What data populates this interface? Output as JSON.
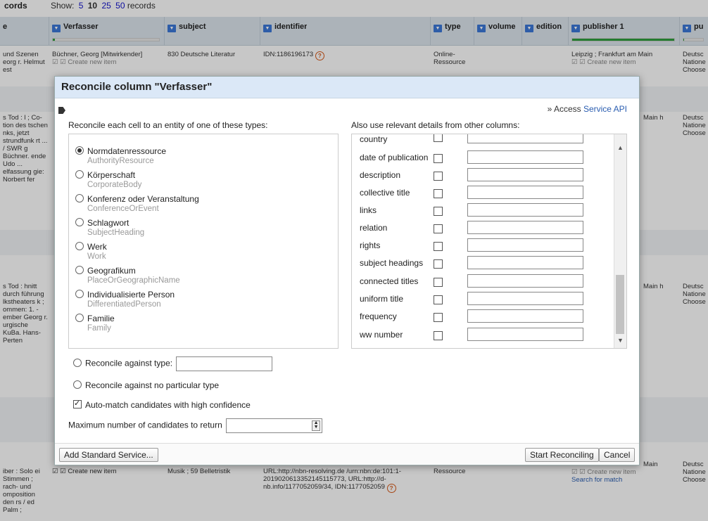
{
  "topbar": {
    "records_label": "cords",
    "show_label": "Show:",
    "opt5": "5",
    "opt10": "10",
    "opt25": "25",
    "opt50": "50",
    "records_suffix": "records"
  },
  "columns": [
    {
      "name": "e",
      "has_menu": false
    },
    {
      "name": "Verfasser",
      "has_menu": true
    },
    {
      "name": "subject",
      "has_menu": true
    },
    {
      "name": "identifier",
      "has_menu": true
    },
    {
      "name": "type",
      "has_menu": true
    },
    {
      "name": "volume",
      "has_menu": true
    },
    {
      "name": "edition",
      "has_menu": true
    },
    {
      "name": "publisher 1",
      "has_menu": true
    },
    {
      "name": "pu",
      "has_menu": true
    }
  ],
  "grid": {
    "row1": {
      "c0": "und Szenen eorg r. Helmut est",
      "c1": "Büchner, Georg [Mitwirkender]",
      "c1b": "Create new item",
      "c2": "830 Deutsche Literatur",
      "c3": "IDN:1186196173",
      "c4": "Online-Ressource",
      "c7": "Leipzig ; Frankfurt am Main",
      "c7b": "Create new item",
      "c8": "Deutsc Natione Choose"
    },
    "row2": {
      "c0": "s Tod : l ; Co- tion des tschen nks, jetzt strundfunk rt ... / SWR g Büchner. ende Udo ... elfassung gie: Norbert fer",
      "c7": "Main h",
      "c8": "Deutsc Natione Choose"
    },
    "row3": {
      "c0": "s Tod : hnitt durch führung lkstheaters k ; ommen: 1. - ember Georg r. urgische KuBa. Hans- Perten",
      "c7": "Main h",
      "c8": "Deutsc Natione Choose"
    },
    "row4": {
      "c0": "iber : Solo ei Stimmen ; rach- und omposition den rs / ed Palm ;",
      "c1": "Create new item",
      "c2": "Musik ; 59 Belletristik",
      "c3": "URL:http://nbn-resolving.de /urn:nbn:de:101:1-2019020613352145115773, URL:http://d-nb.info/1177052059/34, IDN:1177052059",
      "c4": "Ressource",
      "c7": "Main",
      "c7b": "Create new item",
      "c7c": "Search for match",
      "c8": "Deutsc Natione Choose"
    }
  },
  "dialog": {
    "title": "Reconcile column \"Verfasser\"",
    "access_prefix": "» Access",
    "access_link": "Service API",
    "left_label": "Reconcile each cell to an entity of one of these types:",
    "right_label": "Also use relevant details from other columns:",
    "types": [
      {
        "name": "Normdatenressource",
        "id": "AuthorityResource",
        "selected": true
      },
      {
        "name": "Körperschaft",
        "id": "CorporateBody",
        "selected": false
      },
      {
        "name": "Konferenz oder Veranstaltung",
        "id": "ConferenceOrEvent",
        "selected": false
      },
      {
        "name": "Schlagwort",
        "id": "SubjectHeading",
        "selected": false
      },
      {
        "name": "Werk",
        "id": "Work",
        "selected": false
      },
      {
        "name": "Geografikum",
        "id": "PlaceOrGeographicName",
        "selected": false
      },
      {
        "name": "Individualisierte Person",
        "id": "DifferentiatedPerson",
        "selected": false
      },
      {
        "name": "Familie",
        "id": "Family",
        "selected": false
      }
    ],
    "columns_list": [
      "country",
      "date of publication",
      "description",
      "collective title",
      "links",
      "relation",
      "rights",
      "subject headings",
      "connected titles",
      "uniform title",
      "frequency",
      "ww number"
    ],
    "reconcile_against_type": "Reconcile against type:",
    "reconcile_no_type": "Reconcile against no particular type",
    "auto_match": "Auto-match candidates with high confidence",
    "auto_match_checked": true,
    "max_candidates": "Maximum number of candidates to return",
    "add_service": "Add Standard Service...",
    "start": "Start Reconciling",
    "cancel": "Cancel"
  }
}
